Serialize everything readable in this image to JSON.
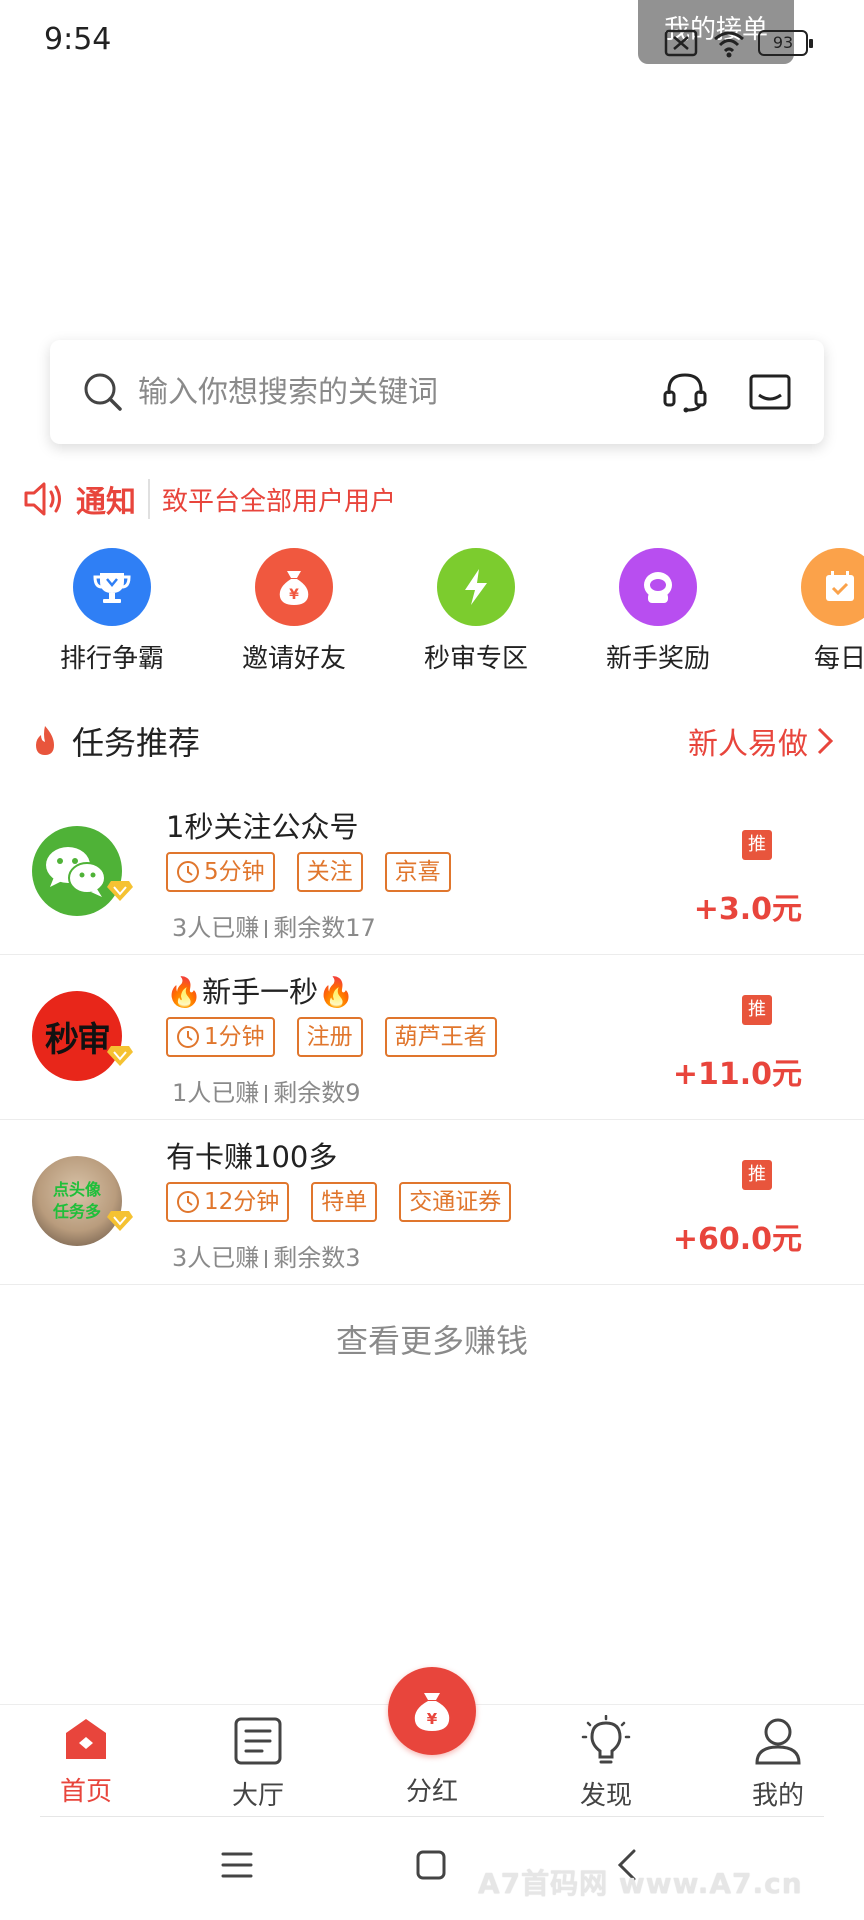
{
  "status_bar": {
    "time": "9:54",
    "toast": "我的接单",
    "battery": "93"
  },
  "search": {
    "placeholder": "输入你想搜索的关键词",
    "icons": [
      "search-icon",
      "headset-icon",
      "inbox-icon"
    ]
  },
  "notice": {
    "title": "通知",
    "text": "致平台全部用户用户",
    "icon": "speaker-icon"
  },
  "quick_actions": [
    {
      "label": "排行争霸",
      "icon": "trophy-icon",
      "color": "#2f7ff5"
    },
    {
      "label": "邀请好友",
      "icon": "money-bag-icon",
      "color": "#f0583f"
    },
    {
      "label": "秒审专区",
      "icon": "lightning-icon",
      "color": "#7ccc2e"
    },
    {
      "label": "新手奖励",
      "icon": "mascot-icon",
      "color": "#b84ef0"
    },
    {
      "label": "每日",
      "icon": "calendar-icon",
      "color": "#fba24a"
    }
  ],
  "section": {
    "title": "任务推荐",
    "link": "新人易做",
    "icon": "flame-icon"
  },
  "tasks": [
    {
      "title": "1秒关注公众号",
      "tags": [
        "5分钟",
        "关注",
        "京喜"
      ],
      "earned": "3人已赚",
      "remaining": "剩余数17",
      "rec": "推",
      "reward": "+3.0元",
      "avatar_icon": "wechat-icon"
    },
    {
      "title": "🔥新手一秒🔥",
      "tags": [
        "1分钟",
        "注册",
        "葫芦王者"
      ],
      "earned": "1人已赚",
      "remaining": "剩余数9",
      "rec": "推",
      "reward": "+11.0元",
      "avatar_text": "秒审"
    },
    {
      "title": "有卡赚100多",
      "tags": [
        "12分钟",
        "特单",
        "交通证券"
      ],
      "earned": "3人已赚",
      "remaining": "剩余数3",
      "rec": "推",
      "reward": "+60.0元",
      "avatar_text": "点头像 任务多"
    }
  ],
  "view_more": "查看更多赚钱",
  "bottom_nav": [
    {
      "label": "首页",
      "icon": "home-icon",
      "active": true
    },
    {
      "label": "大厅",
      "icon": "list-icon",
      "active": false
    },
    {
      "label": "分红",
      "icon": "money-bag-icon",
      "active": false
    },
    {
      "label": "发现",
      "icon": "bulb-icon",
      "active": false
    },
    {
      "label": "我的",
      "icon": "user-icon",
      "active": false
    }
  ],
  "watermark": "A7首码网 www.A7.cn",
  "colors": {
    "accent": "#e8453c",
    "tag": "#e0762d"
  }
}
